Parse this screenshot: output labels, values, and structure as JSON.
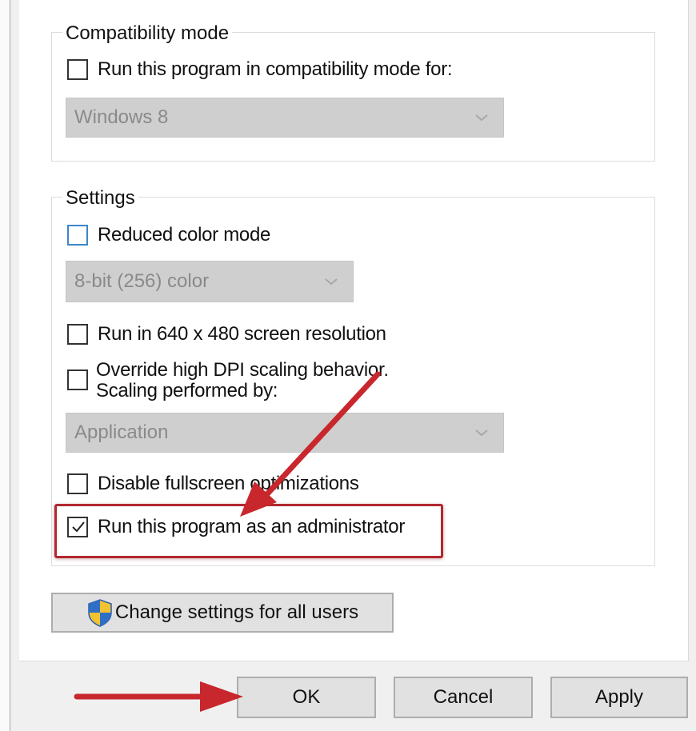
{
  "compatibility": {
    "group_title": "Compatibility mode",
    "checkbox_label": "Run this program in compatibility mode for:",
    "checked": false,
    "os_dropdown_value": "Windows 8"
  },
  "settings": {
    "group_title": "Settings",
    "reduced_color": {
      "label": "Reduced color mode",
      "checked": false
    },
    "color_dropdown_value": "8-bit (256) color",
    "run_640": {
      "label": "Run in 640 x 480 screen resolution",
      "checked": false
    },
    "override_dpi": {
      "label_line1": "Override high DPI scaling behavior.",
      "label_line2": "Scaling performed by:",
      "checked": false
    },
    "scaling_dropdown_value": "Application",
    "disable_fullscreen": {
      "label": "Disable fullscreen optimizations",
      "checked": false
    },
    "run_as_admin": {
      "label": "Run this program as an administrator",
      "checked": true
    }
  },
  "change_settings_button": {
    "label": "Change settings for all users",
    "icon": "uac-shield-icon"
  },
  "footer": {
    "ok_label": "OK",
    "cancel_label": "Cancel",
    "apply_label": "Apply"
  },
  "annotation_colors": {
    "arrow": "#c8272d",
    "highlight_box": "#b22830"
  }
}
